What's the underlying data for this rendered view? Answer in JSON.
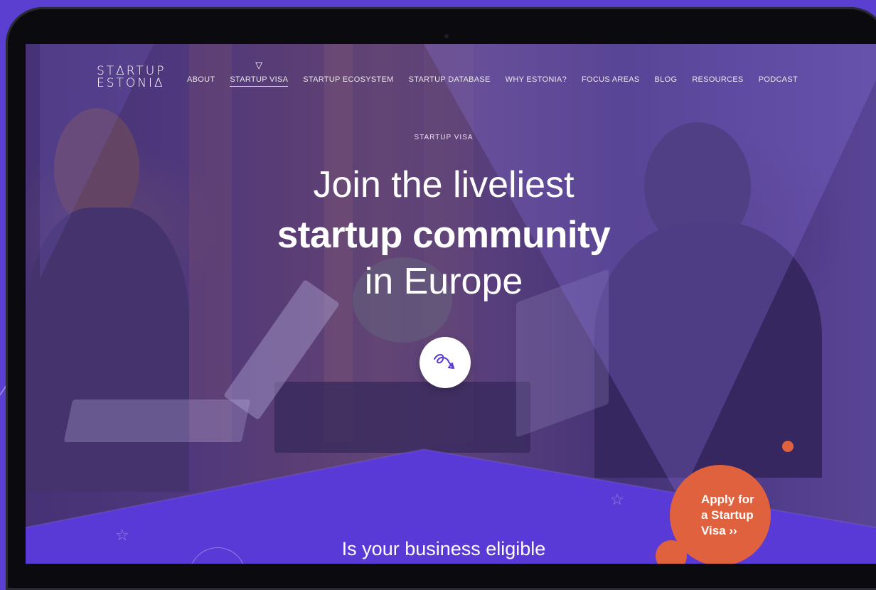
{
  "brand": {
    "logo_line1": "STΔRTUP",
    "logo_line2": "ESTONIΔ"
  },
  "nav": {
    "items": [
      {
        "label": "ABOUT"
      },
      {
        "label": "STARTUP VISA",
        "active": true
      },
      {
        "label": "STARTUP ECOSYSTEM"
      },
      {
        "label": "STARTUP DATABASE"
      },
      {
        "label": "WHY ESTONIA?"
      },
      {
        "label": "FOCUS AREAS"
      },
      {
        "label": "BLOG"
      },
      {
        "label": "RESOURCES"
      },
      {
        "label": "PODCAST"
      }
    ],
    "active_marker_icon": "triangle-down-icon"
  },
  "hero": {
    "eyebrow": "STARTUP VISA",
    "headline_line1": "Join the liveliest",
    "headline_line2": "startup community",
    "headline_line3": "in Europe",
    "scroll_button_icon": "swirl-arrow-icon"
  },
  "section": {
    "heading": "Is your business eligible"
  },
  "apply": {
    "line1": "Apply for",
    "line2": "a Startup",
    "line3": "Visa ››"
  },
  "colors": {
    "background": "#5b3fd1",
    "accent": "#e0613e",
    "section_purple": "#5a3ad6"
  }
}
